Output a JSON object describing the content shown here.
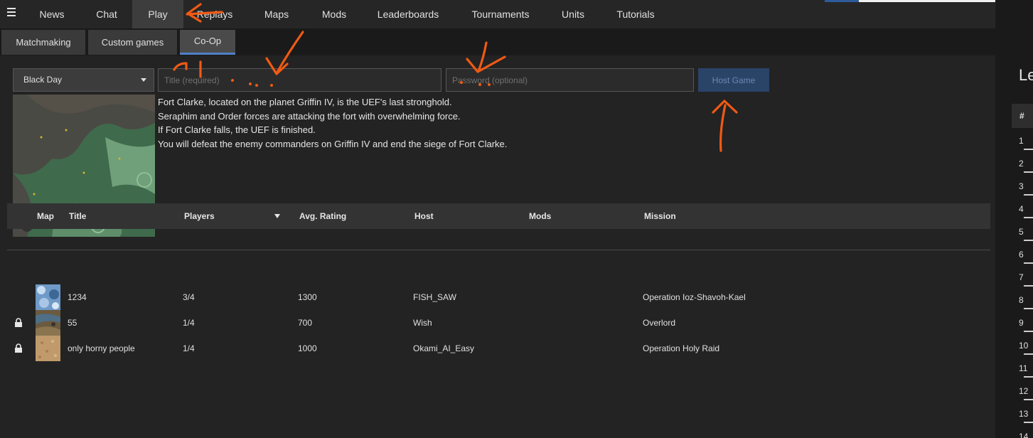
{
  "nav": {
    "tabs": [
      {
        "label": "News"
      },
      {
        "label": "Chat"
      },
      {
        "label": "Play"
      },
      {
        "label": "Replays"
      },
      {
        "label": "Maps"
      },
      {
        "label": "Mods"
      },
      {
        "label": "Leaderboards"
      },
      {
        "label": "Tournaments"
      },
      {
        "label": "Units"
      },
      {
        "label": "Tutorials"
      }
    ],
    "active": "Play"
  },
  "subnav": {
    "tabs": [
      {
        "label": "Matchmaking"
      },
      {
        "label": "Custom games"
      },
      {
        "label": "Co-Op"
      }
    ],
    "active": "Co-Op"
  },
  "form": {
    "mission_select": "Black Day",
    "title_placeholder": "Title (required)",
    "password_placeholder": "Password (optional)",
    "host_button": "Host Game"
  },
  "description": {
    "lines": [
      "Fort Clarke, located on the planet Griffin IV, is the UEF's last stronghold.",
      "Seraphim and Order forces are attacking the fort with overwhelming force.",
      "If Fort Clarke falls, the UEF is finished.",
      "You will defeat the enemy commanders on Griffin IV and end the siege of Fort Clarke."
    ]
  },
  "table": {
    "headers": {
      "map": "Map",
      "title": "Title",
      "players": "Players",
      "rating": "Avg. Rating",
      "host": "Host",
      "mods": "Mods",
      "mission": "Mission"
    },
    "rows": [
      {
        "locked": false,
        "title": "1234",
        "players": "3/4",
        "rating": "1300",
        "host": "FISH_SAW",
        "mods": "",
        "mission": "Operation Ioz-Shavoh-Kael",
        "thumb_color": "#6f9ac8"
      },
      {
        "locked": true,
        "title": "55",
        "players": "1/4",
        "rating": "700",
        "host": "Wish",
        "mods": "",
        "mission": "Overlord",
        "thumb_color": "#6b5a40"
      },
      {
        "locked": true,
        "title": "only horny people",
        "players": "1/4",
        "rating": "1000",
        "host": "Okami_AI_Easy",
        "mods": "",
        "mission": "Operation Holy Raid",
        "thumb_color": "#c09a6a"
      }
    ]
  },
  "leaderboard": {
    "title": "Le",
    "rank_header": "#",
    "ranks": [
      "1",
      "2",
      "3",
      "4",
      "5",
      "6",
      "7",
      "8",
      "9",
      "10",
      "11",
      "12",
      "13",
      "14"
    ]
  },
  "colors": {
    "accent": "#4f82c9",
    "annotation": "#f05a14",
    "host_button_bg": "#2a4468"
  }
}
